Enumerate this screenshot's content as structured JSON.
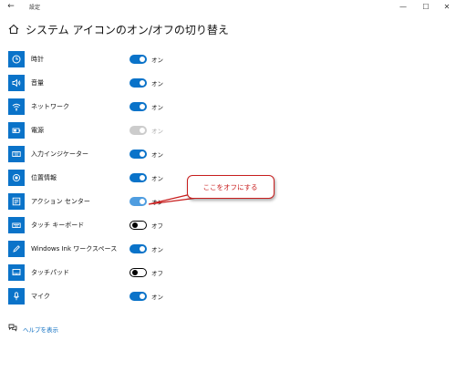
{
  "window": {
    "title": "設定",
    "back_glyph": "←",
    "min_glyph": "—",
    "max_glyph": "☐",
    "close_glyph": "✕"
  },
  "header": {
    "title": "システム アイコンのオン/オフの切り替え"
  },
  "rows": [
    {
      "label": "時計",
      "state": "オン",
      "toggle": "on"
    },
    {
      "label": "音量",
      "state": "オン",
      "toggle": "on"
    },
    {
      "label": "ネットワーク",
      "state": "オン",
      "toggle": "on"
    },
    {
      "label": "電源",
      "state": "オン",
      "toggle": "disabled"
    },
    {
      "label": "入力インジケーター",
      "state": "オン",
      "toggle": "on"
    },
    {
      "label": "位置情報",
      "state": "オン",
      "toggle": "on"
    },
    {
      "label": "アクション センター",
      "state": "オン",
      "toggle": "on"
    },
    {
      "label": "タッチ キーボード",
      "state": "オフ",
      "toggle": "off"
    },
    {
      "label": "Windows Ink ワークスペース",
      "state": "オン",
      "toggle": "on"
    },
    {
      "label": "タッチパッド",
      "state": "オフ",
      "toggle": "off"
    },
    {
      "label": "マイク",
      "state": "オン",
      "toggle": "on"
    }
  ],
  "callout": {
    "text": "ここをオフにする",
    "color": "#c81e1e"
  },
  "help": {
    "label": "ヘルプを表示"
  },
  "colors": {
    "accent": "#0a73c9",
    "link": "#0a6cc0",
    "disabled": "#cccccc"
  }
}
